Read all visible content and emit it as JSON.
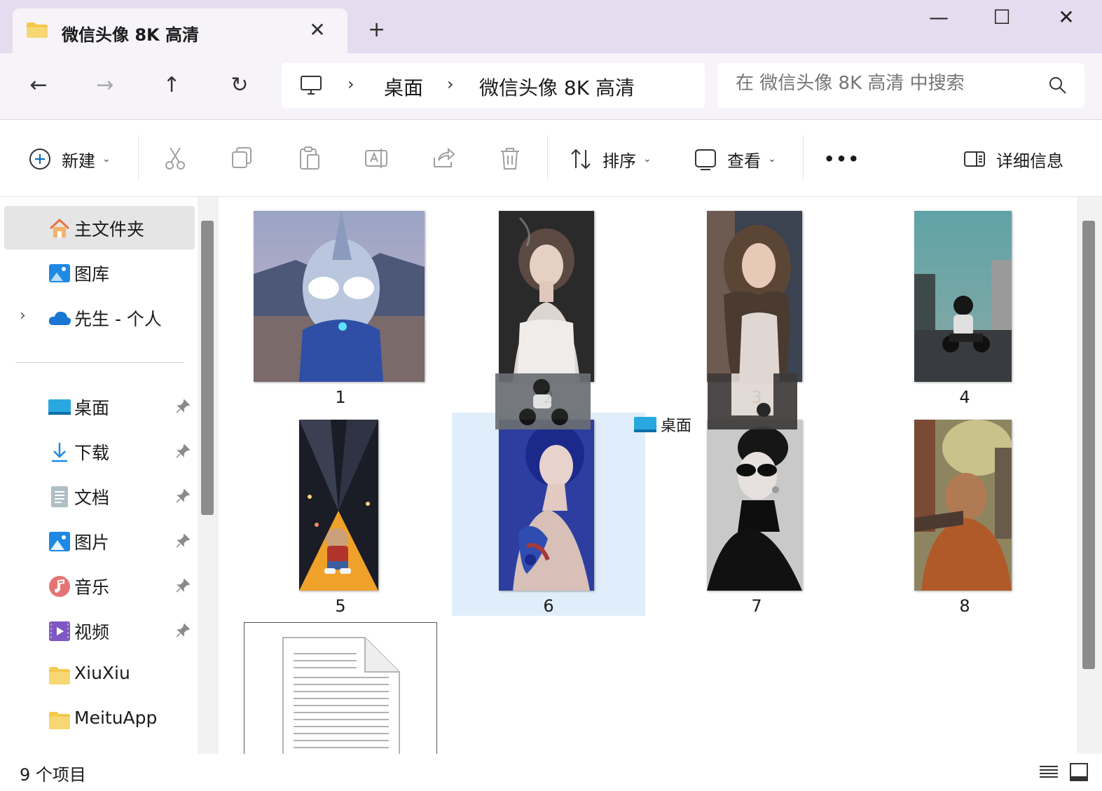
{
  "window": {
    "tab_title": "微信头像 8K 高清",
    "tab_close": "✕",
    "new_tab": "+",
    "minimize": "—",
    "maximize": "☐",
    "close": "✕"
  },
  "nav": {
    "back": "←",
    "forward": "→",
    "up": "↑",
    "refresh": "↻",
    "breadcrumb": [
      "桌面",
      "微信头像 8K 高清"
    ],
    "separator": "›",
    "search_placeholder": "在 微信头像 8K 高清 中搜索"
  },
  "toolbar": {
    "new_label": "新建",
    "sort_label": "排序",
    "view_label": "查看",
    "more_label": "•••",
    "details_label": "详细信息"
  },
  "sidebar": {
    "items": [
      {
        "label": "主文件夹",
        "icon": "home-icon",
        "selected": true
      },
      {
        "label": "图库",
        "icon": "gallery-icon"
      },
      {
        "label": "先生 - 个人",
        "icon": "onedrive-cloud-icon",
        "expander": "›"
      },
      {
        "label": "桌面",
        "icon": "desktop-icon",
        "pinned": true
      },
      {
        "label": "下载",
        "icon": "download-icon",
        "pinned": true
      },
      {
        "label": "文档",
        "icon": "document-icon",
        "pinned": true
      },
      {
        "label": "图片",
        "icon": "pictures-icon",
        "pinned": true
      },
      {
        "label": "音乐",
        "icon": "music-icon",
        "pinned": true
      },
      {
        "label": "视频",
        "icon": "video-icon",
        "pinned": true
      },
      {
        "label": "XiuXiu",
        "icon": "folder-icon"
      },
      {
        "label": "MeituApp",
        "icon": "folder-icon"
      }
    ]
  },
  "files": [
    {
      "name": "1",
      "kind": "image",
      "subject": "toy-hero"
    },
    {
      "name": "2",
      "kind": "image",
      "subject": "portrait"
    },
    {
      "name": "3",
      "kind": "image",
      "subject": "portrait"
    },
    {
      "name": "4",
      "kind": "image",
      "subject": "motorbike"
    },
    {
      "name": "5",
      "kind": "image",
      "subject": "cat-street"
    },
    {
      "name": "6",
      "kind": "image",
      "subject": "tattoo-portrait",
      "selected": true
    },
    {
      "name": "7",
      "kind": "image",
      "subject": "sunglasses-portrait"
    },
    {
      "name": "8",
      "kind": "image",
      "subject": "old-man"
    },
    {
      "name": "",
      "kind": "text-document"
    }
  ],
  "drag_tooltip": "桌面",
  "status": {
    "item_count": "9 个项目"
  },
  "colors": {
    "titlebar": "#e6dcef",
    "selection": "#e0eefb",
    "accent": "#0067c0",
    "folder": "#f2c94c"
  }
}
